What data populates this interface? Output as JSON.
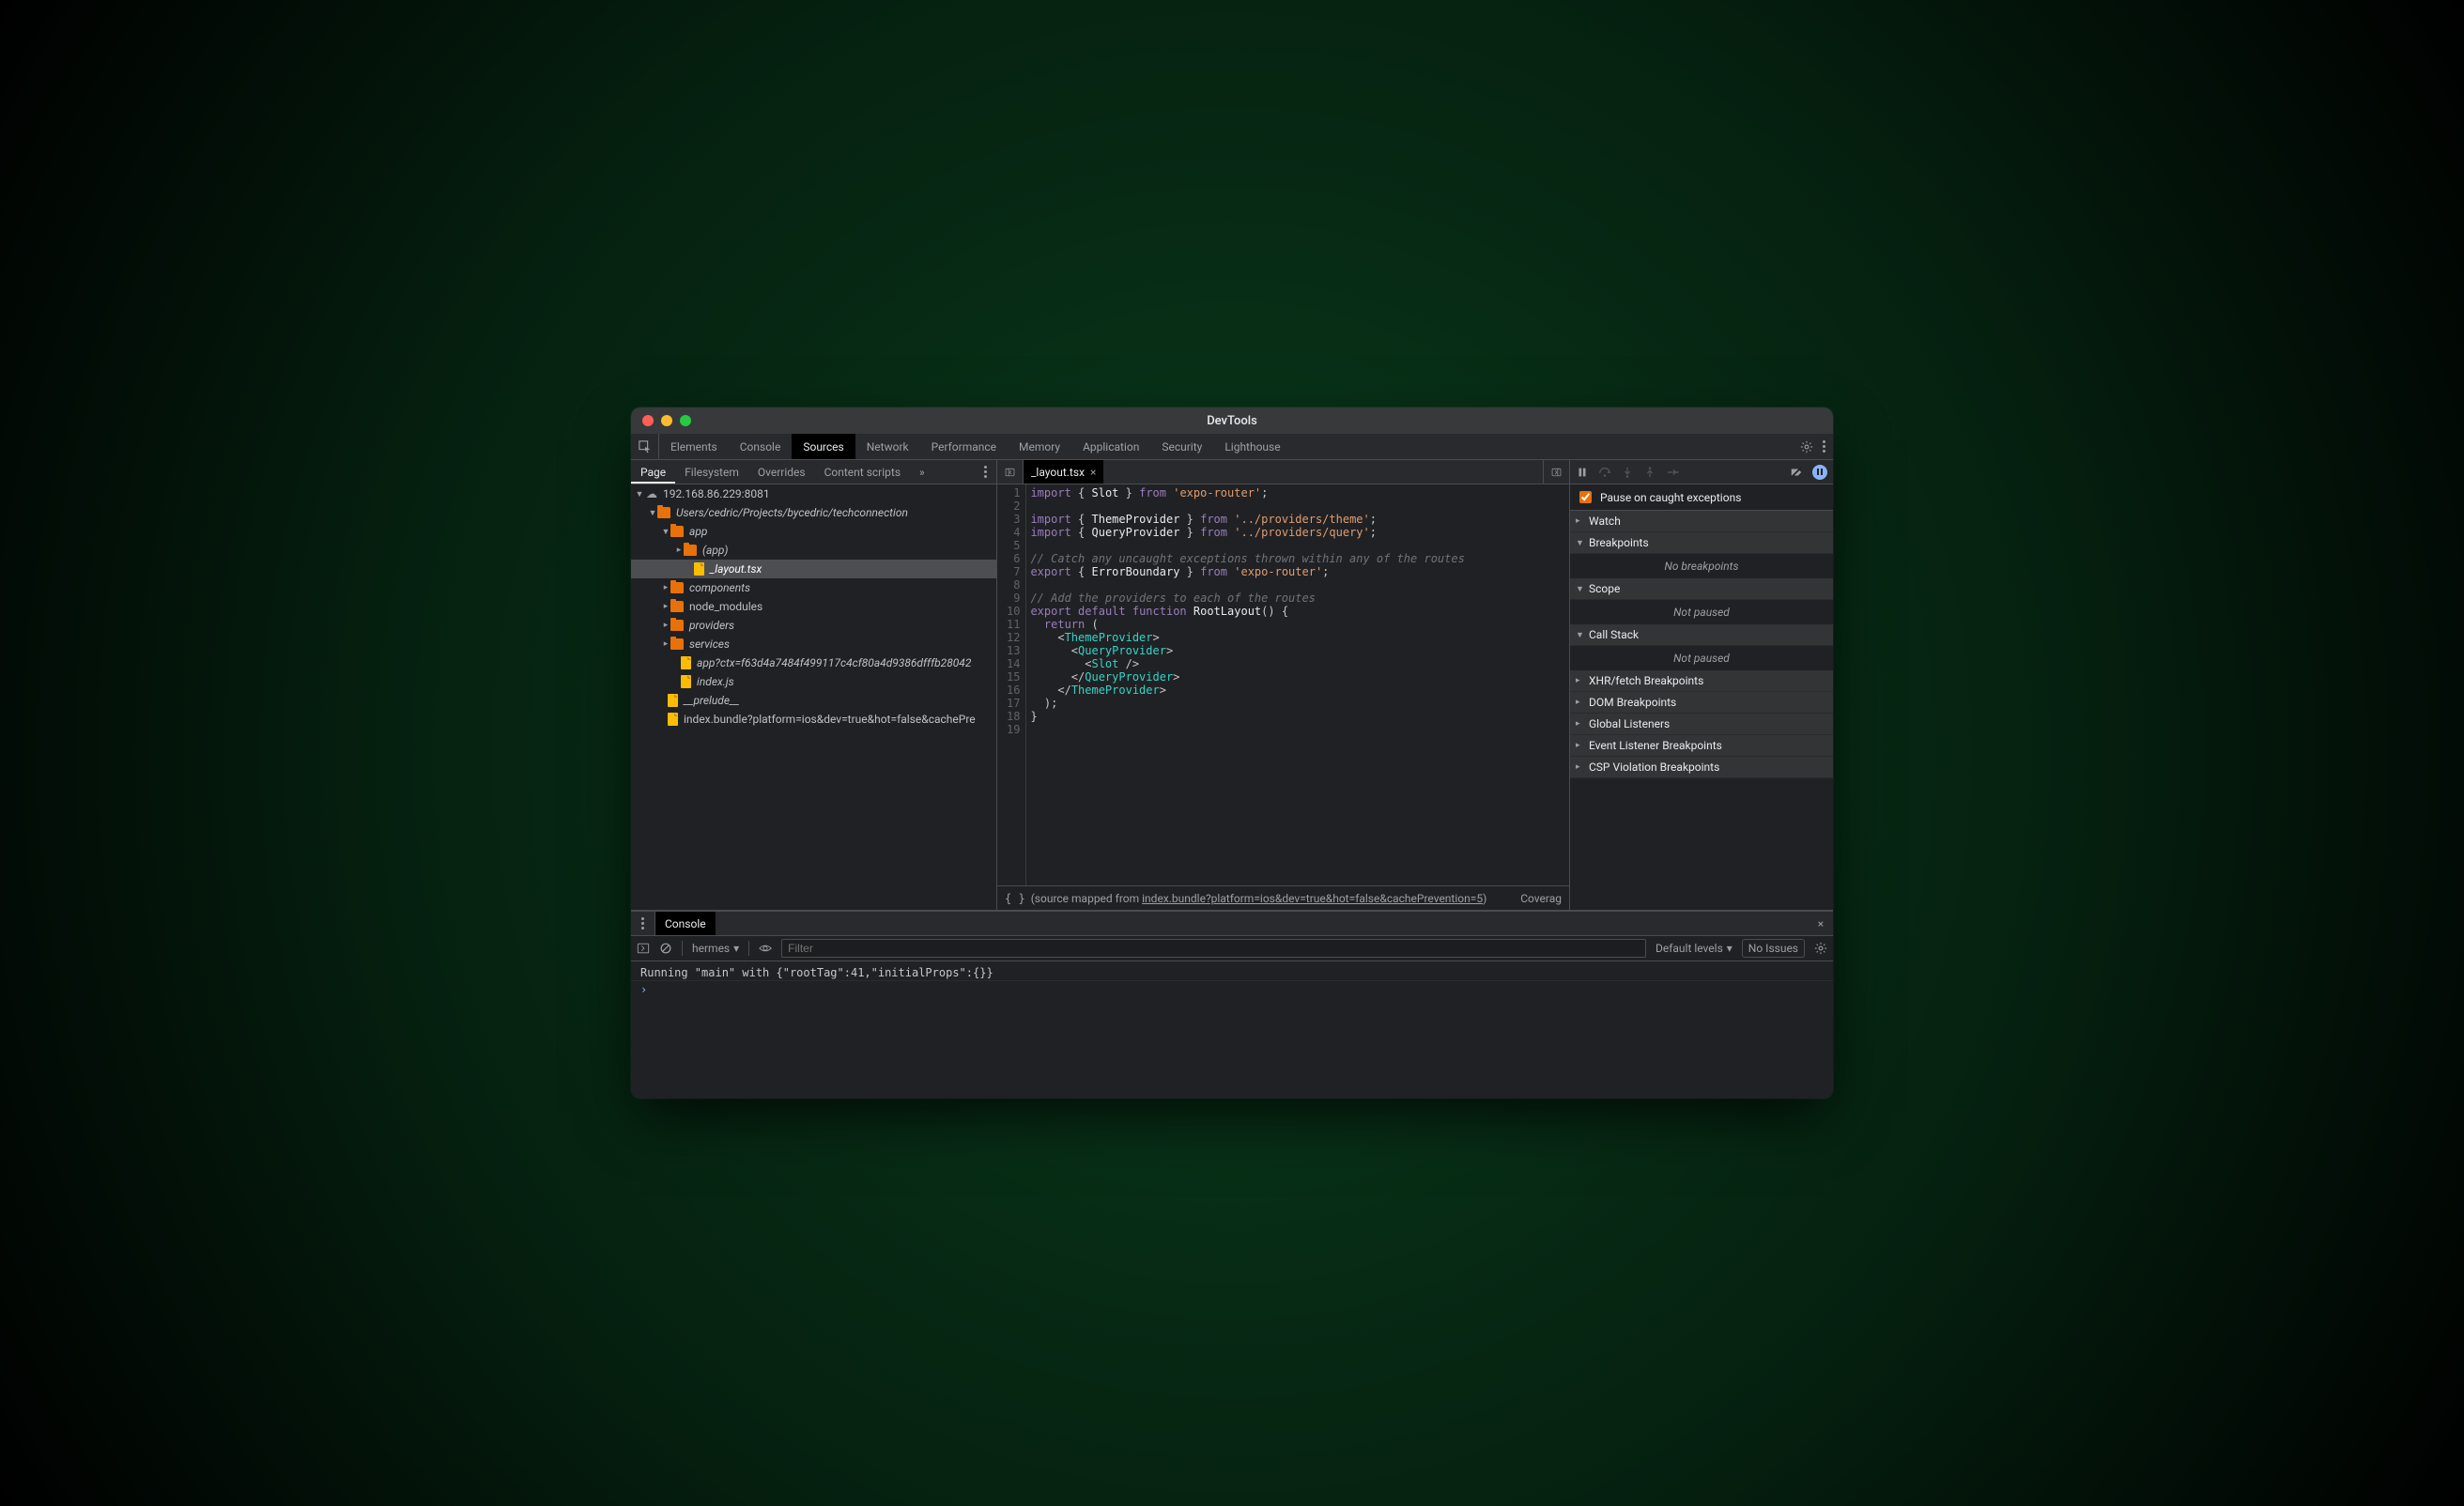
{
  "window_title": "DevTools",
  "main_tabs": [
    "Elements",
    "Console",
    "Sources",
    "Network",
    "Performance",
    "Memory",
    "Application",
    "Security",
    "Lighthouse"
  ],
  "main_tabs_active": "Sources",
  "navigator": {
    "tabs": [
      "Page",
      "Filesystem",
      "Overrides",
      "Content scripts"
    ],
    "active_tab": "Page",
    "root_host": "192.168.86.229:8081",
    "root_path": "Users/cedric/Projects/bycedric/techconnection",
    "selected_file": "_layout.tsx",
    "tree": {
      "app": {
        "name": "app",
        "children": [
          {
            "name": "(app)",
            "type": "folder",
            "italic": true
          },
          {
            "name": "_layout.tsx",
            "type": "file",
            "italic": true,
            "selected": true
          }
        ]
      },
      "siblings": [
        {
          "name": "components",
          "type": "folder",
          "italic": true
        },
        {
          "name": "node_modules",
          "type": "folder"
        },
        {
          "name": "providers",
          "type": "folder",
          "italic": true
        },
        {
          "name": "services",
          "type": "folder",
          "italic": true
        },
        {
          "name": "app?ctx=f63d4a7484f499117c4cf80a4d9386dfffb28042",
          "type": "file",
          "italic": true
        },
        {
          "name": "index.js",
          "type": "file",
          "italic": true
        }
      ],
      "root_siblings": [
        {
          "name": "__prelude__",
          "type": "file",
          "italic": true
        },
        {
          "name": "index.bundle?platform=ios&dev=true&hot=false&cachePre",
          "type": "file"
        }
      ]
    }
  },
  "editor": {
    "tab_name": "_layout.tsx",
    "lines": [
      [
        [
          "kw",
          "import"
        ],
        [
          "",
          " { "
        ],
        [
          "id",
          "Slot"
        ],
        [
          "",
          " } "
        ],
        [
          "kw",
          "from"
        ],
        [
          "",
          " "
        ],
        [
          "str",
          "'expo-router'"
        ],
        [
          "",
          ";"
        ]
      ],
      [],
      [
        [
          "kw",
          "import"
        ],
        [
          "",
          " { "
        ],
        [
          "id",
          "ThemeProvider"
        ],
        [
          "",
          " } "
        ],
        [
          "kw",
          "from"
        ],
        [
          "",
          " "
        ],
        [
          "str",
          "'../providers/theme'"
        ],
        [
          "",
          ";"
        ]
      ],
      [
        [
          "kw",
          "import"
        ],
        [
          "",
          " { "
        ],
        [
          "id",
          "QueryProvider"
        ],
        [
          "",
          " } "
        ],
        [
          "kw",
          "from"
        ],
        [
          "",
          " "
        ],
        [
          "str",
          "'../providers/query'"
        ],
        [
          "",
          ";"
        ]
      ],
      [],
      [
        [
          "com",
          "// Catch any uncaught exceptions thrown within any of the routes"
        ]
      ],
      [
        [
          "kw",
          "export"
        ],
        [
          "",
          " { "
        ],
        [
          "id",
          "ErrorBoundary"
        ],
        [
          "",
          " } "
        ],
        [
          "kw",
          "from"
        ],
        [
          "",
          " "
        ],
        [
          "str",
          "'expo-router'"
        ],
        [
          "",
          ";"
        ]
      ],
      [],
      [
        [
          "com",
          "// Add the providers to each of the routes"
        ]
      ],
      [
        [
          "kw",
          "export"
        ],
        [
          "",
          " "
        ],
        [
          "kw",
          "default"
        ],
        [
          "",
          " "
        ],
        [
          "kw",
          "function"
        ],
        [
          "",
          " "
        ],
        [
          "id",
          "RootLayout"
        ],
        [
          "",
          "() {"
        ]
      ],
      [
        [
          "",
          "  "
        ],
        [
          "kw",
          "return"
        ],
        [
          "",
          " ("
        ]
      ],
      [
        [
          "",
          "    <"
        ],
        [
          "typ",
          "ThemeProvider"
        ],
        [
          "",
          ">"
        ]
      ],
      [
        [
          "",
          "      <"
        ],
        [
          "typ",
          "QueryProvider"
        ],
        [
          "",
          ">"
        ]
      ],
      [
        [
          "",
          "        <"
        ],
        [
          "typ",
          "Slot"
        ],
        [
          "",
          " />"
        ]
      ],
      [
        [
          "",
          "      </"
        ],
        [
          "typ",
          "QueryProvider"
        ],
        [
          "",
          ">"
        ]
      ],
      [
        [
          "",
          "    </"
        ],
        [
          "typ",
          "ThemeProvider"
        ],
        [
          "",
          ">"
        ]
      ],
      [
        [
          "",
          "  );"
        ]
      ],
      [
        [
          "",
          "}"
        ]
      ],
      []
    ],
    "source_map_prefix": "(source mapped from ",
    "source_map_link": "index.bundle?platform=ios&dev=true&hot=false&cachePrevention=5",
    "source_map_suffix": ")",
    "coverage_label": "Coverag"
  },
  "debugger": {
    "pause_caught_label": "Pause on caught exceptions",
    "sections": [
      {
        "title": "Watch",
        "open": false
      },
      {
        "title": "Breakpoints",
        "open": true,
        "body": "No breakpoints"
      },
      {
        "title": "Scope",
        "open": true,
        "body": "Not paused"
      },
      {
        "title": "Call Stack",
        "open": true,
        "body": "Not paused"
      },
      {
        "title": "XHR/fetch Breakpoints",
        "open": false
      },
      {
        "title": "DOM Breakpoints",
        "open": false
      },
      {
        "title": "Global Listeners",
        "open": false
      },
      {
        "title": "Event Listener Breakpoints",
        "open": false
      },
      {
        "title": "CSP Violation Breakpoints",
        "open": false
      }
    ]
  },
  "drawer": {
    "tab": "Console",
    "context": "hermes",
    "filter_placeholder": "Filter",
    "levels_label": "Default levels",
    "issues_label": "No Issues",
    "log": "Running \"main\" with {\"rootTag\":41,\"initialProps\":{}}"
  }
}
